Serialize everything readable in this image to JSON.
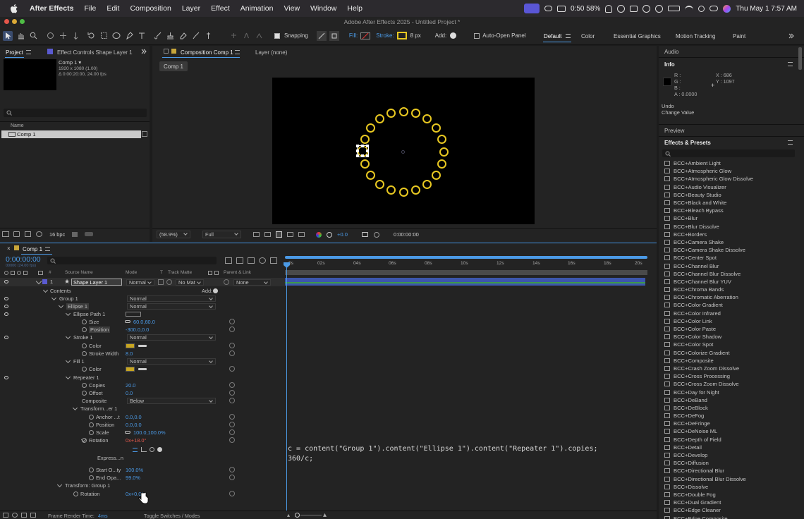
{
  "menubar": {
    "app": "After Effects",
    "items": [
      "File",
      "Edit",
      "Composition",
      "Layer",
      "Effect",
      "Animation",
      "View",
      "Window",
      "Help"
    ],
    "battery_pct": "0:50 58%",
    "clock": "Thu May 1  7:57 AM"
  },
  "window": {
    "title": "Adobe After Effects 2025 - Untitled Project *"
  },
  "toolbar": {
    "snapping": "Snapping",
    "fill": "Fill:",
    "stroke": "Stroke:",
    "stroke_px": "8 px",
    "add": "Add:",
    "auto_open": "Auto-Open Panel"
  },
  "workspaces": [
    "Default",
    "Color",
    "Essential Graphics",
    "Motion Tracking",
    "Paint"
  ],
  "project": {
    "tab": "Project",
    "effect_tab": "Effect Controls Shape Layer 1",
    "comp_name": "Comp 1 ▾",
    "comp_res": "1920 x 1080 (1.00)",
    "comp_dur": "Δ 0:00:20:00, 24.00 fps",
    "col_name": "Name",
    "item": "Comp 1",
    "bpc": "16 bpc"
  },
  "comp": {
    "tab": "Composition Comp 1",
    "layer_tab": "Layer (none)",
    "crumb": "Comp 1",
    "zoom": "(58.9%)",
    "res": "Full",
    "exposure": "+0.0",
    "time": "0:00:00:00"
  },
  "info": {
    "audio": "Audio",
    "title": "Info",
    "r": "R :",
    "g": "G :",
    "b": "B :",
    "a": "A : 0.0000",
    "x": "X : 686",
    "y": "Y : 1097",
    "undo": "Undo",
    "undo_val": "Change Value",
    "preview": "Preview",
    "effects_presets": "Effects & Presets"
  },
  "effects": [
    "BCC+Ambient Light",
    "BCC+Atmospheric Glow",
    "BCC+Atmospheric Glow Dissolve",
    "BCC+Audio Visualizer",
    "BCC+Beauty Studio",
    "BCC+Black and White",
    "BCC+Bleach Bypass",
    "BCC+Blur",
    "BCC+Blur Dissolve",
    "BCC+Borders",
    "BCC+Camera Shake",
    "BCC+Camera Shake Dissolve",
    "BCC+Center Spot",
    "BCC+Channel Blur",
    "BCC+Channel Blur Dissolve",
    "BCC+Channel Blur YUV",
    "BCC+Chroma Bands",
    "BCC+Chromatic Aberration",
    "BCC+Color Gradient",
    "BCC+Color Infrared",
    "BCC+Color Link",
    "BCC+Color Paste",
    "BCC+Color Shadow",
    "BCC+Color Spot",
    "BCC+Colorize Gradient",
    "BCC+Composite",
    "BCC+Crash Zoom Dissolve",
    "BCC+Cross Processing",
    "BCC+Cross Zoom Dissolve",
    "BCC+Day for Night",
    "BCC+DeBand",
    "BCC+DeBlock",
    "BCC+DeFog",
    "BCC+DeFringe",
    "BCC+DeNoise ML",
    "BCC+Depth of Field",
    "BCC+Detail",
    "BCC+Develop",
    "BCC+Diffusion",
    "BCC+Directional Blur",
    "BCC+Directional Blur Dissolve",
    "BCC+Dissolve",
    "BCC+Double Fog",
    "BCC+Dual Gradient",
    "BCC+Edge Cleaner",
    "BCC+Edge Composite"
  ],
  "timeline": {
    "tab": "Comp 1",
    "timecode": "0:00:00:00",
    "sub_timecode": "00000 (24.00 fps)",
    "col_source": "Source Name",
    "col_mode": "Mode",
    "col_t": "T",
    "col_track": "Track Matte",
    "col_parent": "Parent & Link",
    "ruler": [
      "0s",
      "02s",
      "04s",
      "06s",
      "08s",
      "10s",
      "12s",
      "14s",
      "16s",
      "18s",
      "20s"
    ],
    "layer_num": "1",
    "layer_name": "Shape Layer 1",
    "layer_mode": "Normal",
    "matte": "No Mat",
    "parent": "None",
    "contents": "Contents",
    "add": "Add:",
    "frame_render": "Frame Render Time:",
    "render_ms": "4ms",
    "toggle": "Toggle Switches / Modes"
  },
  "rows": [
    {
      "label": "Group 1",
      "mode": "Normal"
    },
    {
      "label": "Ellipse 1",
      "mode": "Normal"
    },
    {
      "label": "Ellipse Path 1"
    },
    {
      "label": "Size",
      "value": "60.0,60.0"
    },
    {
      "label": "Position",
      "value": "-300.0,0.0"
    },
    {
      "label": "Stroke 1",
      "mode": "Normal"
    },
    {
      "label": "Color"
    },
    {
      "label": "Stroke Width",
      "value": "8.0"
    },
    {
      "label": "Fill 1",
      "mode": "Normal"
    },
    {
      "label": "Color"
    },
    {
      "label": "Repeater 1"
    },
    {
      "label": "Copies",
      "value": "20.0"
    },
    {
      "label": "Offset",
      "value": "0.0"
    },
    {
      "label": "Composite",
      "mode": "Below"
    },
    {
      "label": "Transform...er 1"
    },
    {
      "label": "Anchor ...t",
      "value": "0.0,0.0"
    },
    {
      "label": "Position",
      "value": "0.0,0.0"
    },
    {
      "label": "Scale",
      "value": "100.0,100.0%"
    },
    {
      "label": "Rotation",
      "value": "0x+18.0°"
    },
    {
      "label": "Express...n"
    },
    {
      "label": "Start O...ty",
      "value": "100.0%"
    },
    {
      "label": "End Opa...",
      "value": "99.0%"
    },
    {
      "label": "Transform: Group 1"
    },
    {
      "label": "Rotation",
      "value": "0x+0.0°"
    }
  ],
  "expression": {
    "line1": "c = content(\"Group 1\").content(\"Ellipse 1\").content(\"Repeater 1\").copies;",
    "line2": "360/c;"
  },
  "colors": {
    "accent": "#4b9ae6",
    "stroke": "#e8c821",
    "red": "#e3584c",
    "bg": "#1c1c1c"
  }
}
